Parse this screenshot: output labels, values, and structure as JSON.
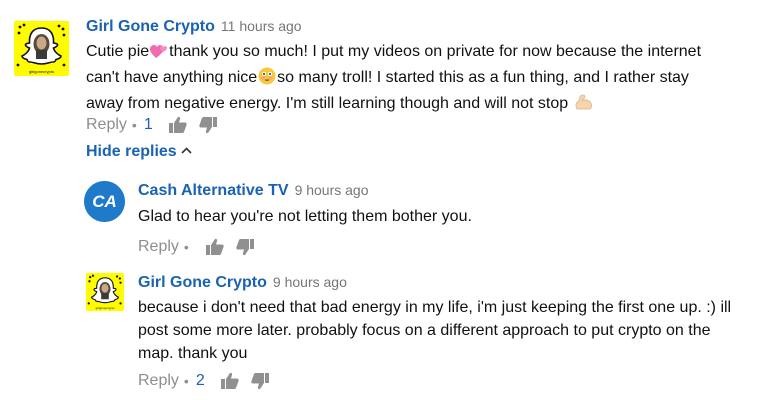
{
  "comments": [
    {
      "author": "Girl Gone Crypto",
      "time": "11 hours ago",
      "text_lines": [
        "Cutie pie",
        "thank you so much! I put my videos on private for now because the internet",
        "can't have anything nice",
        "so many troll! I started this as a fun thing, and I rather stay",
        "away from negative energy. I'm still learning though and will not stop"
      ],
      "emojis": [
        "two-hearts-emoji",
        "flushed-face-emoji",
        "flexed-biceps-emoji"
      ],
      "reply_label": "Reply",
      "likes": "1",
      "avatar": "snapcode-avatar",
      "avatar_caption": "girlgonecrypto"
    }
  ],
  "hide_replies_label": "Hide replies",
  "replies": [
    {
      "author": "Cash Alternative TV",
      "time": "9 hours ago",
      "text": "Glad to hear you're not letting them bother you.",
      "reply_label": "Reply",
      "likes": "",
      "avatar": "ca-logo-avatar",
      "avatar_text": "CA"
    },
    {
      "author": "Girl Gone Crypto",
      "time": "9 hours ago",
      "text_lines": [
        "because i don't need that bad energy in my life, i'm just keeping the first one up. :) ill",
        "post some more later. probably focus on a different approach to put crypto on the",
        "map. thank you"
      ],
      "reply_label": "Reply",
      "likes": "2",
      "avatar": "snapcode-avatar",
      "avatar_caption": "girlgonecrypto"
    }
  ],
  "colors": {
    "author": "#1a62b3",
    "timestamp": "#767676",
    "muted": "#8e8e8e",
    "snapcode_yellow": "#fffc00",
    "ca_blue": "#1f7ac9"
  }
}
